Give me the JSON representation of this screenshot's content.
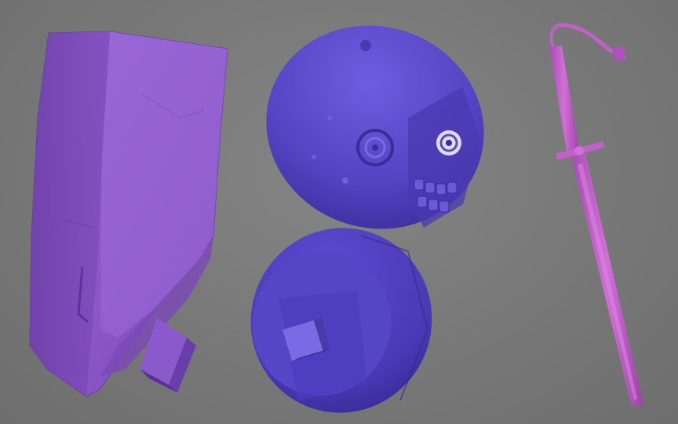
{
  "viewport": {
    "background_color": "#7a7a7a",
    "objects": [
      {
        "name": "rock-slab",
        "color": "#8a54c8"
      },
      {
        "name": "moon-face-top-half",
        "color": "#5a44c8"
      },
      {
        "name": "moon-face-bottom-half",
        "color": "#4e3cb8"
      },
      {
        "name": "sword-with-whip",
        "color": "#c060c8"
      }
    ]
  }
}
